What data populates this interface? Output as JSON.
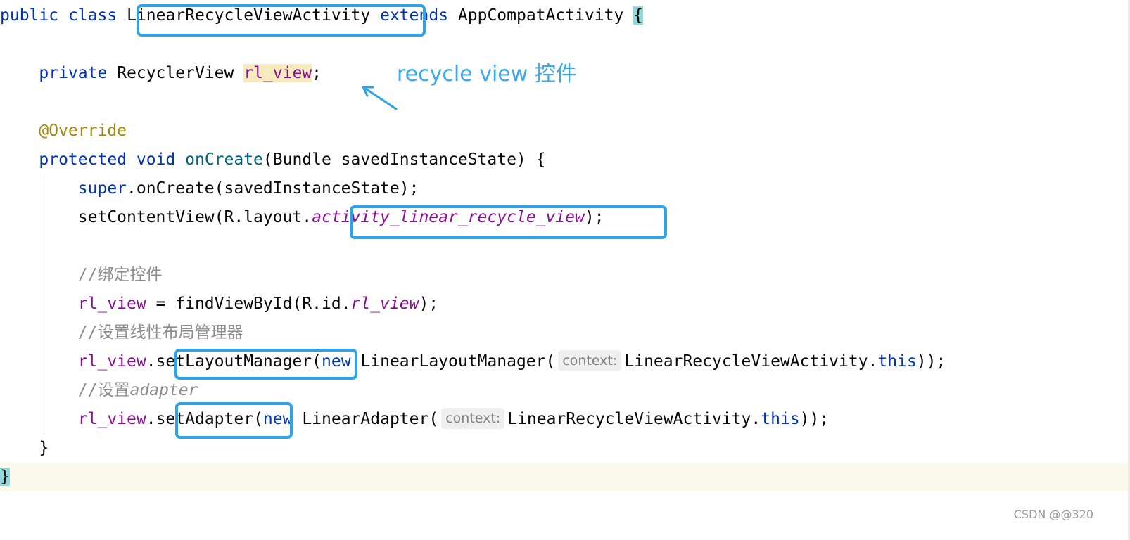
{
  "code": {
    "kw_public": "public",
    "kw_class": "class",
    "class_name": "LinearRecycleViewActivity",
    "kw_extends": "extends",
    "super_class": "AppCompatActivity",
    "open_brace": "{",
    "kw_private": "private",
    "field_type": "RecyclerView",
    "field_name": "rl_view",
    "semicolon": ";",
    "annotation": "@Override",
    "kw_protected": "protected",
    "kw_void": "void",
    "method_name": "onCreate",
    "method_params_open": "(Bundle savedInstanceState) {",
    "kw_super": "super",
    "super_call": ".onCreate(savedInstanceState);",
    "set_content_view": "setContentView(R.layout.",
    "layout_const": "activity_linear_recycle_view",
    "paren_close_semicolon": ");",
    "comment_bind": "//绑定控件",
    "assign_lhs": "rl_view",
    "assign_mid": " = findViewById(R.id.",
    "id_const": "rl_view",
    "comment_layout_manager": "//设置线性布局管理器",
    "dot": ".",
    "set_layout_manager": "setLayoutManager",
    "paren_open": "(",
    "kw_new": "new",
    "linear_layout_manager": "LinearLayoutManager(",
    "hint_context": "context:",
    "activity_ref": "LinearRecycleViewActivity.",
    "kw_this": "this",
    "double_close": "));",
    "comment_adapter_prefix": "//设置",
    "comment_adapter_word": "adapter",
    "set_adapter": "setAdapter",
    "linear_adapter": "LinearAdapter(",
    "method_close_brace": "}",
    "class_close_brace": "}"
  },
  "annotation_note": "recycle view 控件",
  "watermark": "CSDN @@320",
  "colors": {
    "keyword": "#0033b3",
    "method": "#00627a",
    "field": "#871094",
    "annotation": "#9e880d",
    "comment": "#8c8c8c",
    "callout": "#2fa3e8",
    "note_text": "#39a9ec"
  }
}
